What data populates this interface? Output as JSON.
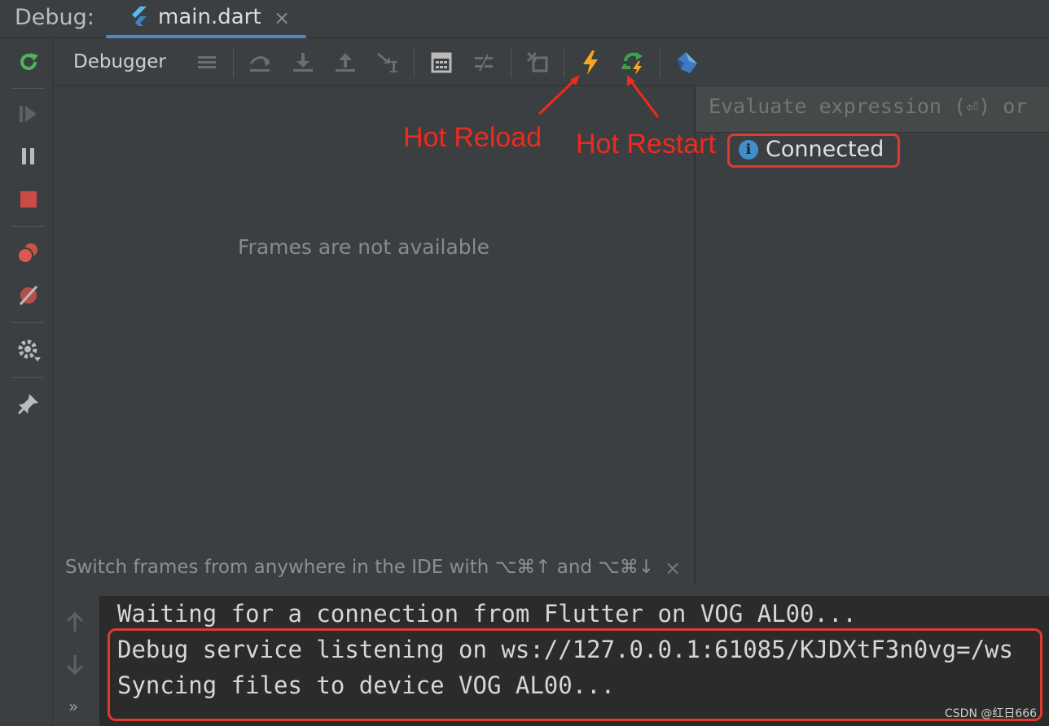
{
  "header": {
    "debug_label": "Debug:",
    "tab_title": "main.dart",
    "tab_close": "×"
  },
  "toolbar": {
    "title": "Debugger"
  },
  "frames": {
    "empty_message": "Frames are not available",
    "hint": "Switch frames from anywhere in the IDE with ⌥⌘↑ and ⌥⌘↓",
    "hint_close": "×"
  },
  "evaluate": {
    "placeholder": "Evaluate expression (⏎) or"
  },
  "status": {
    "text": "Connected"
  },
  "annotations": {
    "hot_reload": "Hot Reload",
    "hot_restart": "Hot Restart"
  },
  "console": {
    "lines": [
      "Waiting for a connection from Flutter on VOG AL00...",
      "Debug service listening on ws://127.0.0.1:61085/KJDXtF3n0vg=/ws",
      "Syncing files to device VOG AL00..."
    ],
    "more": "»"
  },
  "watermark": "CSDN @红日666",
  "colors": {
    "accent": "#4a88c7",
    "annotation_red": "#ee2a1e",
    "hot_reload": "#f5a623",
    "hot_restart": "#3da34a"
  },
  "icons": {
    "left": [
      "rerun-icon",
      "resume-icon",
      "pause-icon",
      "stop-icon",
      "view-breakpoints-icon",
      "mute-breakpoints-icon",
      "settings-icon",
      "pin-icon"
    ],
    "top": [
      "threads-menu-icon",
      "step-over-icon",
      "step-into-icon",
      "step-out-icon",
      "run-to-cursor-icon",
      "evaluate-icon",
      "trace-icon",
      "restore-layout-icon",
      "hot-reload-icon",
      "hot-restart-icon",
      "dart-devtools-icon"
    ]
  }
}
